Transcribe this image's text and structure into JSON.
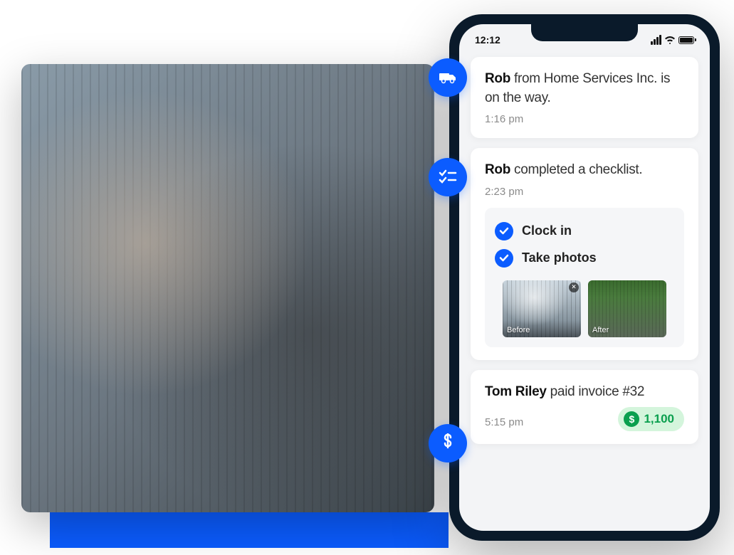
{
  "status_bar": {
    "time": "12:12"
  },
  "notifications": [
    {
      "bold_text": "Rob",
      "rest_text": " from Home Services Inc. is on the way.",
      "time": "1:16 pm",
      "icon": "truck-icon"
    },
    {
      "bold_text": "Rob",
      "rest_text": " completed a checklist.",
      "time": "2:23 pm",
      "icon": "checklist-icon",
      "checklist": {
        "items": [
          "Clock in",
          "Take photos"
        ],
        "photos": [
          {
            "label": "Before"
          },
          {
            "label": "After"
          }
        ]
      }
    },
    {
      "bold_text": "Tom Riley",
      "rest_text": " paid invoice #32",
      "time": "5:15 pm",
      "icon": "dollar-icon",
      "amount": "1,100"
    }
  ],
  "colors": {
    "primary": "#0b5cff",
    "success": "#0a9f4e",
    "success_bg": "#d4f5dc"
  }
}
